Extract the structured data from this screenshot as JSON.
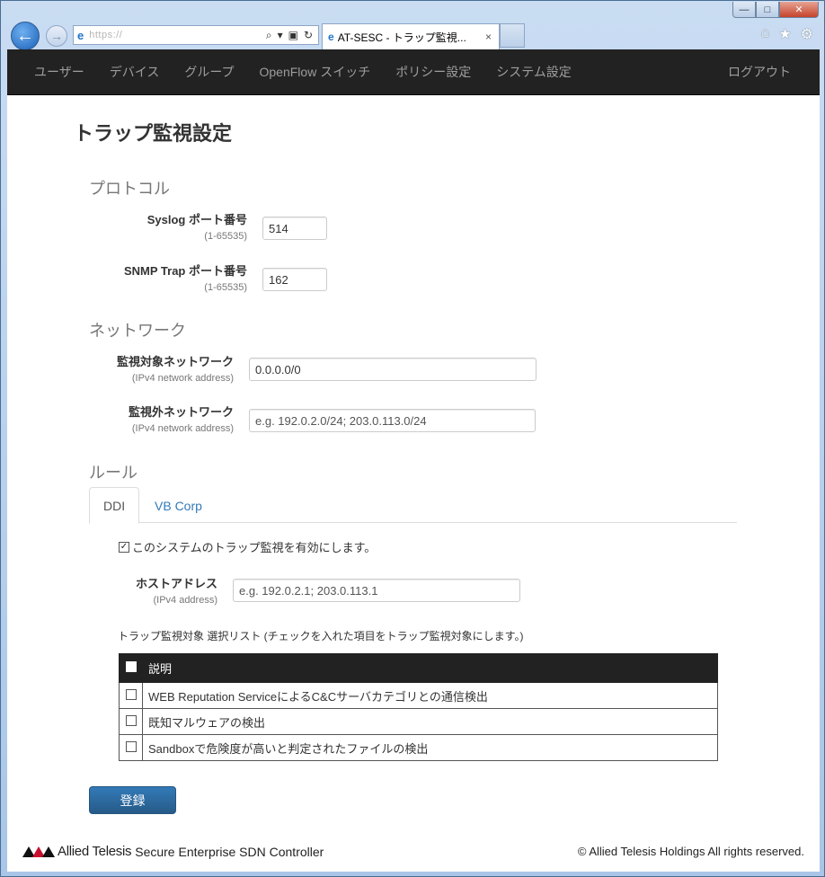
{
  "browser": {
    "address_text": "https://",
    "tab_title": "AT-SESC - トラップ監視...",
    "tab_close": "×",
    "back_glyph": "←",
    "forward_glyph": "→",
    "ie_glyph": "e",
    "search_glyph": "⌕",
    "dropdown_glyph": "▾",
    "lock_glyph": "🔒",
    "refresh_glyph": "↻",
    "home_glyph": "⌂",
    "favorites_glyph": "★",
    "settings_glyph": "⚙",
    "min_glyph": "—",
    "max_glyph": "□",
    "close_glyph": "✕"
  },
  "nav": {
    "items": [
      "ユーザー",
      "デバイス",
      "グループ",
      "OpenFlow スイッチ",
      "ポリシー設定",
      "システム設定"
    ],
    "logout": "ログアウト"
  },
  "page": {
    "title": "トラップ監視設定"
  },
  "protocol": {
    "heading": "プロトコル",
    "syslog": {
      "label": "Syslog ポート番号",
      "hint": "(1-65535)",
      "value": "514"
    },
    "snmp": {
      "label": "SNMP Trap ポート番号",
      "hint": "(1-65535)",
      "value": "162"
    }
  },
  "network": {
    "heading": "ネットワーク",
    "monitored": {
      "label": "監視対象ネットワーク",
      "hint": "(IPv4 network address)",
      "value": "0.0.0.0/0"
    },
    "excluded": {
      "label": "監視外ネットワーク",
      "hint": "(IPv4 network address)",
      "placeholder": "e.g. 192.0.2.0/24; 203.0.113.0/24"
    }
  },
  "rules": {
    "heading": "ルール",
    "tabs": [
      "DDI",
      "VB Corp"
    ],
    "enable_label": "このシステムのトラップ監視を有効にします。",
    "enable_checked": "✓",
    "host": {
      "label": "ホストアドレス",
      "hint": "(IPv4 address)",
      "placeholder": "e.g. 192.0.2.1; 203.0.113.1"
    },
    "list_caption": "トラップ監視対象 選択リスト (チェックを入れた項目をトラップ監視対象にします。)",
    "table": {
      "header": "説明",
      "rows": [
        "WEB Reputation ServiceによるC&Cサーバカテゴリとの通信検出",
        "既知マルウェアの検出",
        "Sandboxで危険度が高いと判定されたファイルの検出"
      ]
    }
  },
  "actions": {
    "register": "登録"
  },
  "footer": {
    "company": "Allied Telesis",
    "product": "Secure Enterprise SDN Controller",
    "copyright": "© Allied Telesis Holdings All rights reserved."
  },
  "colors": {
    "navbar": "#222222",
    "primary": "#337ab7",
    "brand_red": "#c8102e"
  }
}
